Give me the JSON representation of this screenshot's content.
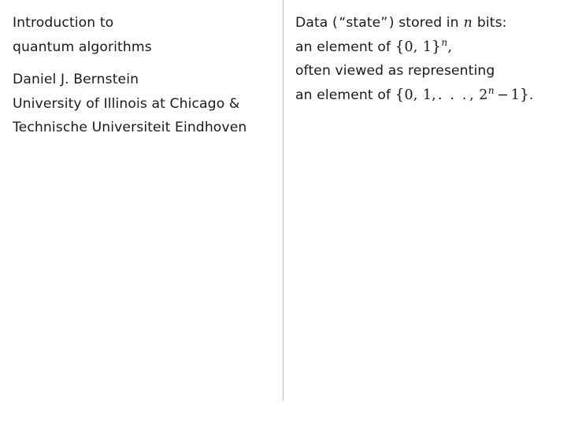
{
  "slide": {
    "background_color": "#ffffff",
    "text_color": "#1a1a1a",
    "divider_color": "#b9b9bd"
  },
  "left_column": {
    "title": {
      "line1": "Introduction to",
      "line2": "quantum algorithms"
    },
    "author": {
      "name": "Daniel J. Bernstein",
      "affiliation1": "University of Illinois at Chicago &",
      "affiliation2": "Technische Universiteit Eindhoven"
    }
  },
  "right_column": {
    "body": {
      "line1_prefix": "Data (",
      "line1_quoted": "“state”",
      "line1_mid": ") stored in",
      "line1_var": "n",
      "line1_suffix": "bits:",
      "line2_prefix": "an element of",
      "line2_set_open": "{",
      "line2_zero": "0",
      "line2_comma": ",",
      "line2_one": "1",
      "line2_set_close": "}",
      "line2_exponent": "n",
      "line2_trailing": ",",
      "line3": "often viewed as representing",
      "line4_prefix": "an element of",
      "line4_set_open": "{",
      "line4_zero": "0",
      "line4_comma1": ",",
      "line4_one": "1",
      "line4_comma2": ",",
      "line4_dots": ". . .",
      "line4_comma3": ",",
      "line4_base": "2",
      "line4_exponent": "n",
      "line4_minus": "−",
      "line4_final": "1",
      "line4_set_close": "}",
      "line4_period": "."
    }
  }
}
